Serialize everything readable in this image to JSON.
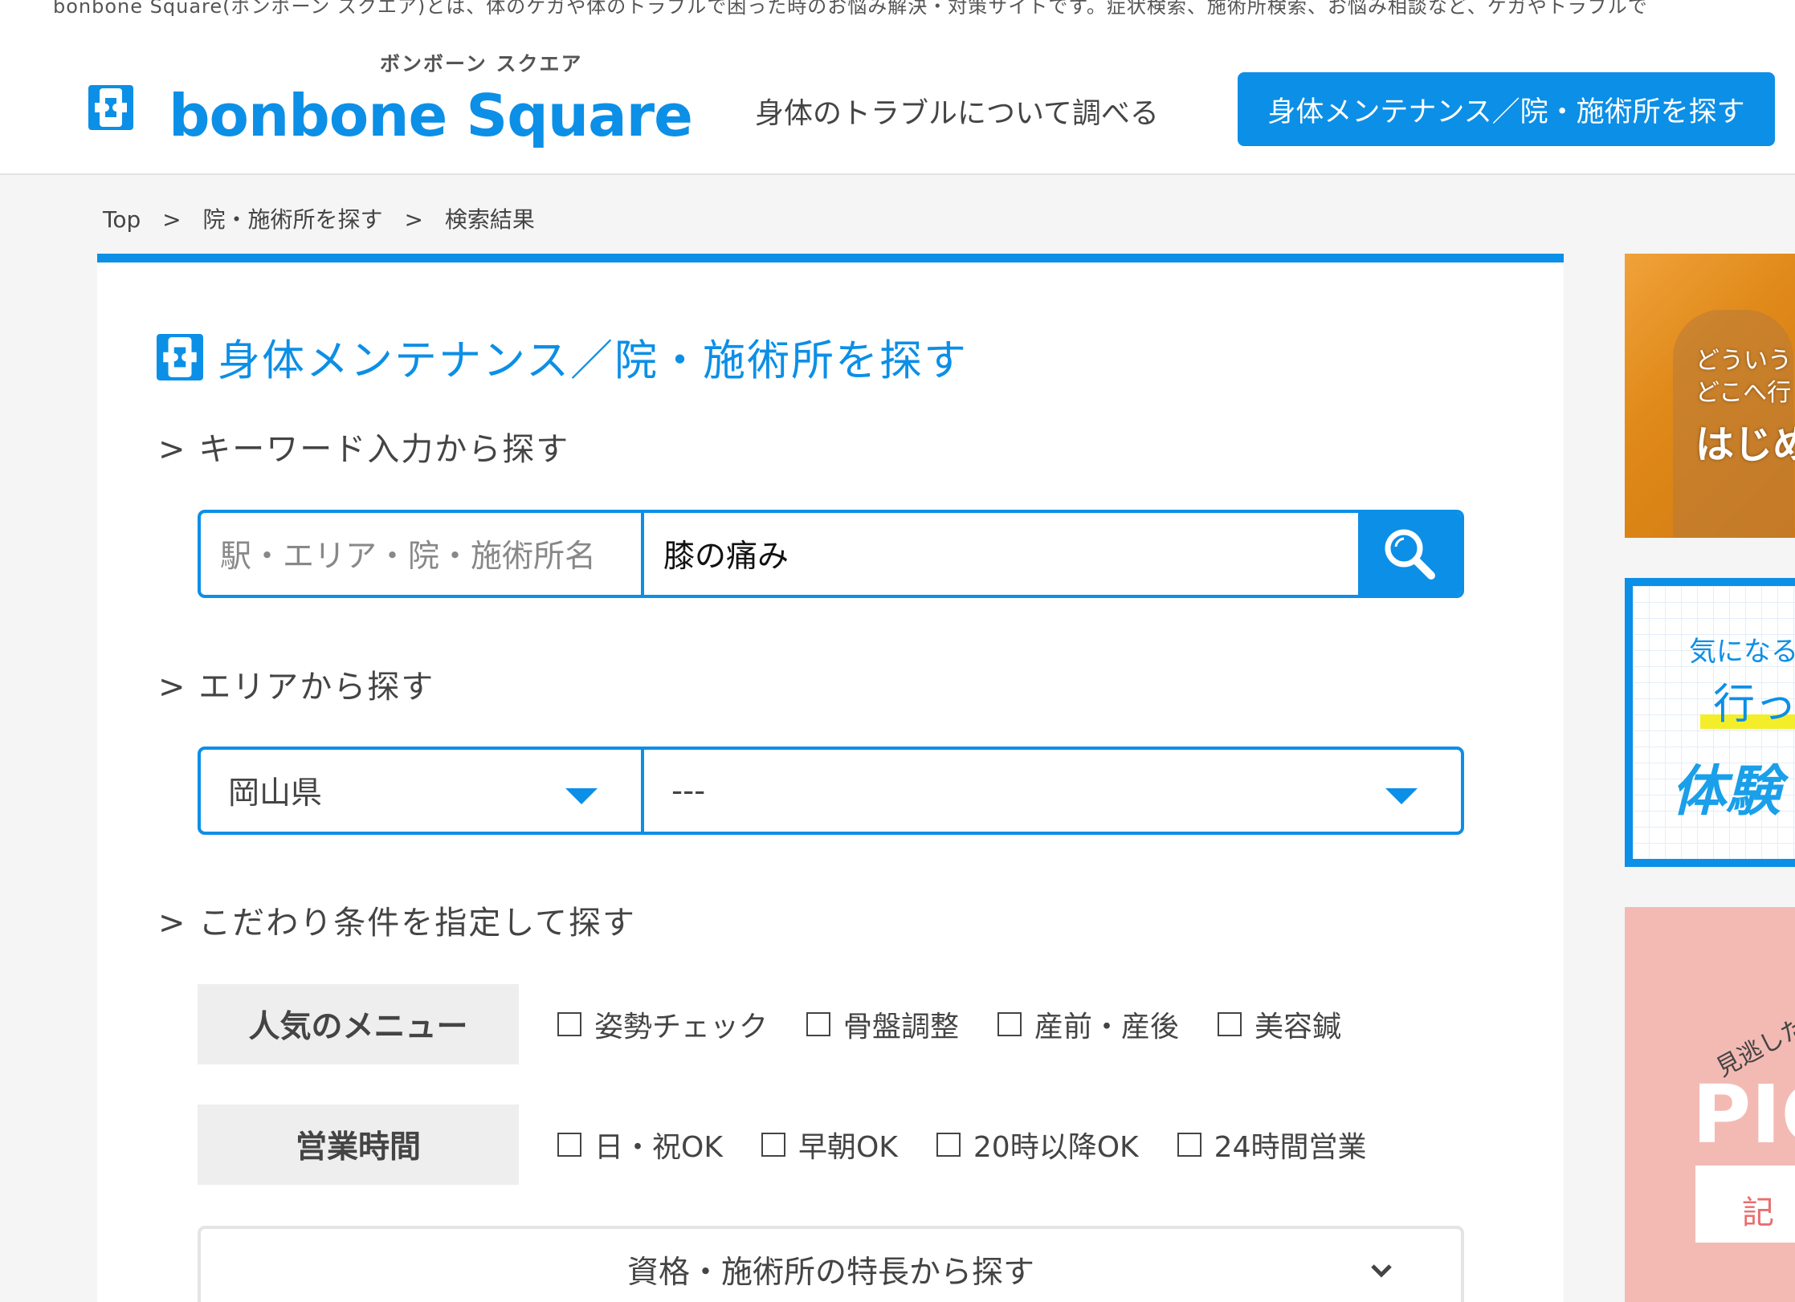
{
  "tagline": "bonbone Square(ボンボーン スクエア)とは、体のケガや体のトラブルで困った時のお悩み解決・対策サイトです。症状検索、施術所検索、お悩み相談など、ケガやトラブルで",
  "header": {
    "logo_kana": "ボンボーン スクエア",
    "logo_text": "bonbone Square",
    "nav_link": "身体のトラブルについて調べる",
    "nav_button": "身体メンテナンス／院・施術所を探す"
  },
  "breadcrumb": [
    "Top",
    ">",
    "院・施術所を探す",
    ">",
    "検索結果"
  ],
  "page_title": "身体メンテナンス／院・施術所を探す",
  "keyword_section": {
    "heading": "> キーワード入力から探す",
    "area_placeholder": "駅・エリア・院・施術所名",
    "keyword_value": "膝の痛み"
  },
  "area_section": {
    "heading": "> エリアから探す",
    "prefecture": "岡山県",
    "city": "---"
  },
  "filter_section": {
    "heading": "> こだわり条件を指定して探す",
    "menu_label": "人気のメニュー",
    "menu_options": [
      "姿勢チェック",
      "骨盤調整",
      "産前・産後",
      "美容鍼"
    ],
    "hours_label": "営業時間",
    "hours_options": [
      "日・祝OK",
      "早朝OK",
      "20時以降OK",
      "24時間営業"
    ],
    "accordion_label": "資格・施術所の特長から探す"
  },
  "sidebar": {
    "ad1": [
      "どういう",
      "どこへ行",
      "はじめ"
    ],
    "ad2": [
      "気になる",
      "行っ",
      "体験"
    ],
    "ad3": [
      "見逃した",
      "PIC",
      "記"
    ]
  },
  "colors": {
    "brand": "#0c8fe6",
    "label_bg": "#eeeeee",
    "page_bg": "#f5f5f5"
  }
}
